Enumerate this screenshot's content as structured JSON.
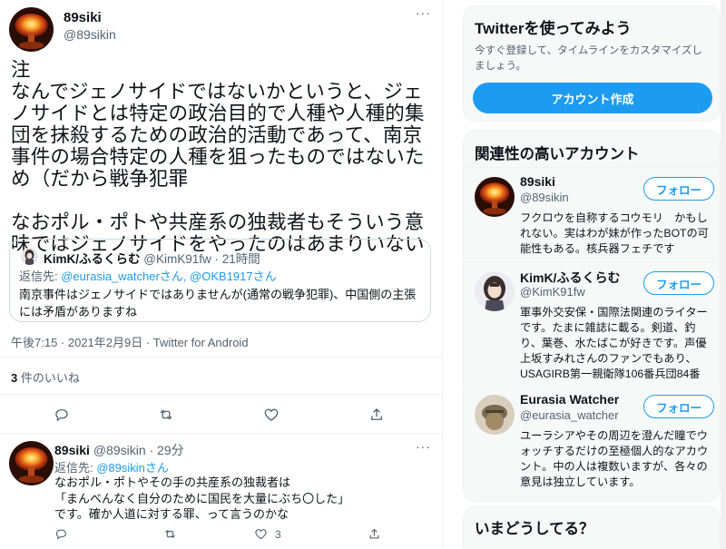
{
  "tweet": {
    "name": "89siki",
    "handle": "@89sikin",
    "more": "···",
    "body": "注\nなんでジェノサイドではないかというと、ジェノサイドとは特定の政治目的で人種や人種的集団を抹殺するための政治的活動であって、南京事件の場合特定の人種を狙ったものではないため（だから戦争犯罪\n\nなおポル・ポトや共産系の独裁者もそういう意味ではジェノサイドをやったのはあまりいない",
    "timestamp": "午後7:15 · 2021年2月9日 · Twitter for Android",
    "likes_count": "3",
    "likes_label": " 件のいいね"
  },
  "quote": {
    "name": "KimK/ふるくらむ",
    "meta": " @KimK91fw · 21時間",
    "reply_prefix": "返信先: ",
    "reply_targets": "@eurasia_watcherさん, @OKB1917さん",
    "text": "南京事件はジェノサイドではありませんが(通常の戦争犯罪)、中国側の主張には矛盾がありますね"
  },
  "reply": {
    "name": "89siki",
    "meta": " @89sikin · 29分",
    "more": "···",
    "reply_prefix": "返信先: ",
    "reply_target": "@89sikinさん",
    "text": "なおポル・ポトやその手の共産系の独裁者は\n「まんべんなく自分のために国民を大量にぶち〇した」\nです。確か人道に対する罪、って言うのかな",
    "retweet_count": "3"
  },
  "sidebar": {
    "signup": {
      "title": "Twitterを使ってみよう",
      "desc": "今すぐ登録して、タイムラインをカスタマイズしましょう。",
      "button": "アカウント作成"
    },
    "related": {
      "title": "関連性の高いアカウント",
      "follow_label": "フォロー",
      "accounts": [
        {
          "name": "89siki",
          "handle": "@89sikin",
          "bio": "フクロウを自称するコウモリ　かもしれない。実はわが妹が作ったBOTの可能性もある。核兵器フェチです"
        },
        {
          "name": "KimK/ふるくらむ",
          "handle": "@KimK91fw",
          "bio": "軍事外交安保・国際法関連のライターです。たまに雑誌に載る。剣道、釣り、葉巻、水たばこが好きです。声優上坂すみれさんのファンでもあり、USAGIRB第一親衛隊106番兵団84番"
        },
        {
          "name": "Eurasia Watcher",
          "handle": "@eurasia_watcher",
          "bio": "ユーラシアやその周辺を澄んだ瞳でウォッチするだけの至極個人的なアカウント。中の人は複数いますが、各々の意見は独立しています。"
        }
      ]
    },
    "trends": {
      "title": "いまどうしてる？"
    }
  },
  "colors": {
    "accent": "#1d9bf0",
    "text": "#0f1419",
    "secondary": "#536471",
    "border": "#eff3f4"
  }
}
